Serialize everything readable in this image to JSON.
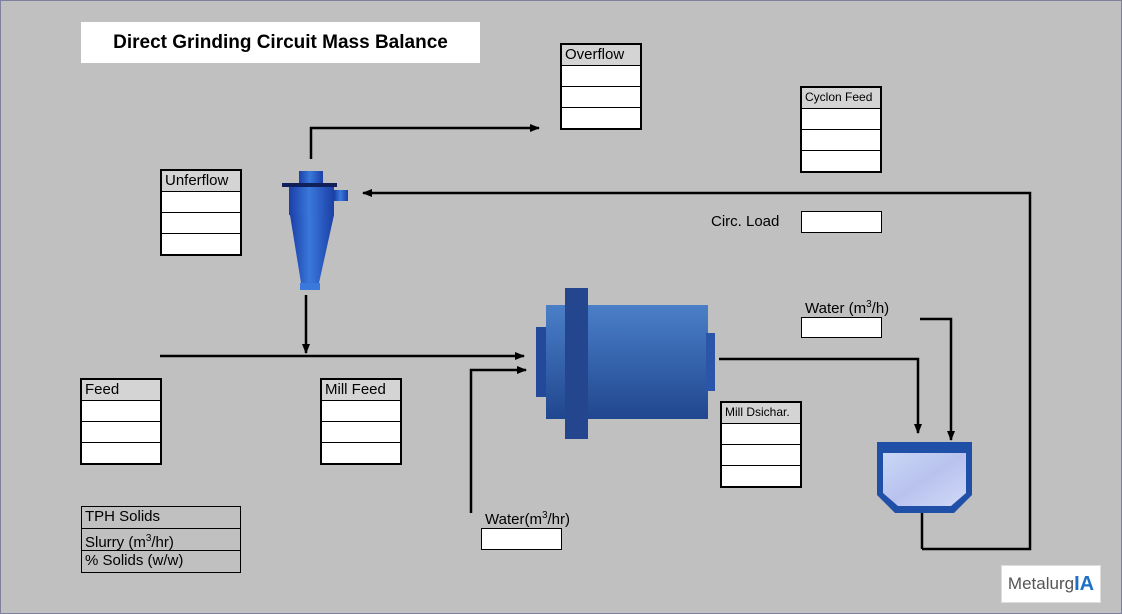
{
  "title": "Direct Grinding Circuit Mass Balance",
  "streams": {
    "overflow": "Overflow",
    "cyclon_feed": "Cyclon Feed",
    "underflow": "Unferflow",
    "feed": "Feed",
    "mill_feed": "Mill Feed",
    "mill_discharge": "Mill Dsichar."
  },
  "labels": {
    "circ_load": "Circ. Load",
    "water_sump_prefix": "Water (m",
    "water_sump_sup": "3",
    "water_sump_suffix": "/h)",
    "water_mill_prefix": "Water(m",
    "water_mill_sup": "3",
    "water_mill_suffix": "/hr)"
  },
  "legend": {
    "tph": "TPH Solids",
    "slurry_prefix": "Slurry (m",
    "slurry_sup": "3",
    "slurry_suffix": "/hr)",
    "solids": "% Solids (w/w)"
  },
  "logo": {
    "part1": "Metalurg",
    "part2": "IA"
  },
  "colors": {
    "background": "#c0c0c0",
    "equipment_blue": "#2e5fb0",
    "header_gray": "#d4d4d4"
  }
}
